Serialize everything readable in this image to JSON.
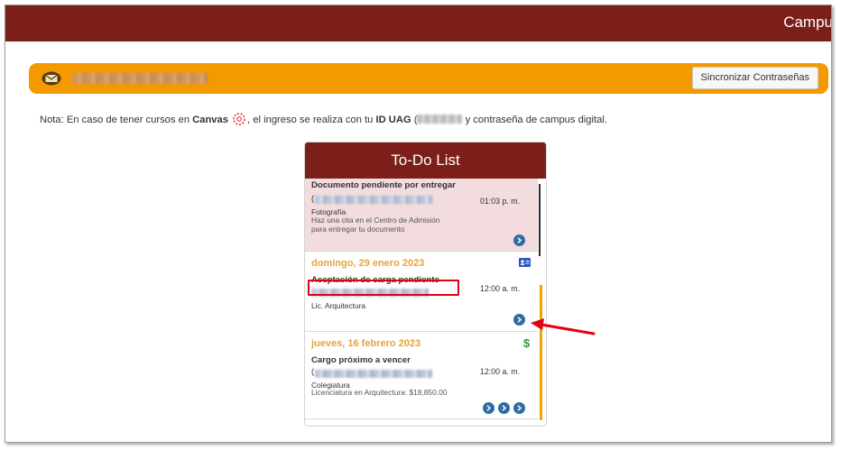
{
  "header": {
    "brand": "Campu"
  },
  "userbar": {
    "email_blurred": "",
    "sync_button": "Sincronizar Contraseñas"
  },
  "note": {
    "prefix": "Nota: En caso de tener cursos en ",
    "canvas": "Canvas",
    "middle": ", el ingreso se realiza con tu ",
    "id_label": "ID UAG",
    "open_paren": " (",
    "suffix": " y contraseña de campus digital."
  },
  "todo": {
    "title": "To-Do List",
    "items": [
      {
        "title": "Documento pendiente por entregar",
        "paren": "(",
        "time": "01:03 p. m.",
        "sub": "Fotografía",
        "desc": "Haz una cita en el Centro de Admisión para entregar tu documento"
      },
      {
        "date": "domingo, 29 enero 2023",
        "title": "Aceptación de carga pendiente",
        "time": "12:00 a. m.",
        "sub": "Lic. Arquitectura"
      },
      {
        "date": "jueves, 16 febrero 2023",
        "title": "Cargo próximo a vencer",
        "paren": "(",
        "time": "12:00 a. m.",
        "sub": "Colegiatura",
        "desc": "Licenciatura en Arquitectura: $18,850.00"
      }
    ]
  },
  "colors": {
    "brand": "#7c1f1a",
    "accent": "#f49a00",
    "link": "#2f6ca6",
    "highlight": "#e3000f"
  },
  "icons": {
    "mail": "mail-icon",
    "canvas": "canvas-logo-icon",
    "id_card": "id-card-icon",
    "dollar": "dollar-icon",
    "go": "chevron-right-circle-icon"
  }
}
